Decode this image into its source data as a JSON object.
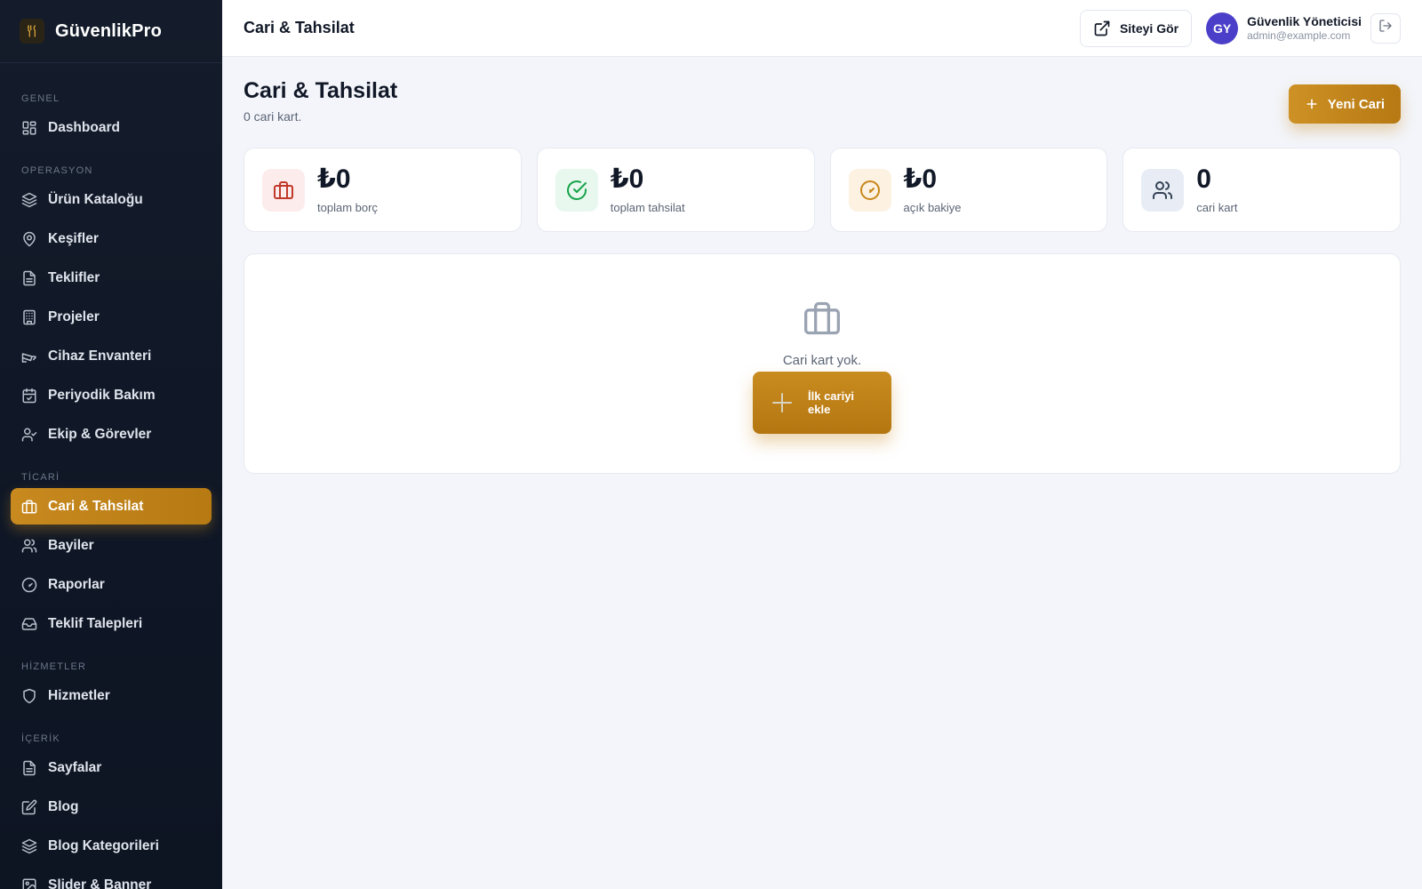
{
  "brand": {
    "name": "GüvenlikPro",
    "icon": "utensils-icon"
  },
  "sidebar": {
    "sections": [
      {
        "title": "GENEL",
        "items": [
          {
            "label": "Dashboard",
            "icon": "grid-icon"
          }
        ]
      },
      {
        "title": "OPERASYON",
        "items": [
          {
            "label": "Ürün Kataloğu",
            "icon": "layers-icon"
          },
          {
            "label": "Keşifler",
            "icon": "map-pin-icon"
          },
          {
            "label": "Teklifler",
            "icon": "file-text-icon"
          },
          {
            "label": "Projeler",
            "icon": "building-icon"
          },
          {
            "label": "Cihaz Envanteri",
            "icon": "cctv-icon"
          },
          {
            "label": "Periyodik Bakım",
            "icon": "calendar-check-icon"
          },
          {
            "label": "Ekip & Görevler",
            "icon": "user-check-icon"
          }
        ]
      },
      {
        "title": "TİCARİ",
        "items": [
          {
            "label": "Cari & Tahsilat",
            "icon": "briefcase-icon",
            "active": true
          },
          {
            "label": "Bayiler",
            "icon": "users-icon"
          },
          {
            "label": "Raporlar",
            "icon": "gauge-icon"
          },
          {
            "label": "Teklif Talepleri",
            "icon": "inbox-icon"
          }
        ]
      },
      {
        "title": "HİZMETLER",
        "items": [
          {
            "label": "Hizmetler",
            "icon": "shield-icon"
          }
        ]
      },
      {
        "title": "İÇERİK",
        "items": [
          {
            "label": "Sayfalar",
            "icon": "file-text-icon"
          },
          {
            "label": "Blog",
            "icon": "edit-icon"
          },
          {
            "label": "Blog Kategorileri",
            "icon": "layers-icon"
          },
          {
            "label": "Slider & Banner",
            "icon": "image-icon"
          }
        ]
      }
    ]
  },
  "header": {
    "title": "Cari & Tahsilat",
    "site_button": "Siteyi Gör",
    "user": {
      "initials": "GY",
      "name": "Güvenlik Yöneticisi",
      "email": "admin@example.com"
    }
  },
  "page": {
    "title": "Cari & Tahsilat",
    "subtitle": "0 cari kart.",
    "new_button": "Yeni Cari"
  },
  "stats": [
    {
      "value": "₺0",
      "label": "toplam borç",
      "icon": "briefcase-icon",
      "color": "#c0392b",
      "bg": "#fdecec"
    },
    {
      "value": "₺0",
      "label": "toplam tahsilat",
      "icon": "check-circle-icon",
      "color": "#16a34a",
      "bg": "#e8f8ee"
    },
    {
      "value": "₺0",
      "label": "açık bakiye",
      "icon": "gauge-icon",
      "color": "#c8861a",
      "bg": "#fdf1e1"
    },
    {
      "value": "0",
      "label": "cari kart",
      "icon": "users-icon",
      "color": "#334155",
      "bg": "#e8edf5"
    }
  ],
  "empty_state": {
    "text": "Cari kart yok.",
    "button": "İlk cariyi ekle"
  },
  "colors": {
    "accent": "#c88a1f",
    "sidebar_bg": "#111a29",
    "avatar": "#4b3fc9"
  }
}
